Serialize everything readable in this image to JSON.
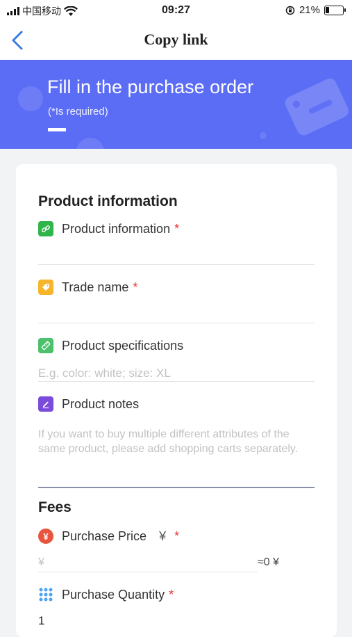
{
  "status_bar": {
    "carrier": "中国移动",
    "time": "09:27",
    "battery_percent": "21%",
    "battery_level": 0.21
  },
  "nav": {
    "title": "Copy link"
  },
  "banner": {
    "title": "Fill in the purchase order",
    "subtitle": "(*Is required)"
  },
  "product_section": {
    "title": "Product information",
    "fields": [
      {
        "label": "Product information",
        "required": "*",
        "value": "",
        "placeholder": ""
      },
      {
        "label": "Trade name",
        "required": "*",
        "value": "",
        "placeholder": ""
      },
      {
        "label": "Product specifications",
        "value": "",
        "placeholder": "E.g. color: white; size: XL"
      },
      {
        "label": "Product notes",
        "value": "",
        "placeholder": "If you want to buy multiple different attributes of the same product, please add shopping carts separately."
      }
    ]
  },
  "fees_section": {
    "title": "Fees",
    "price": {
      "label": "Purchase Price",
      "currency": "¥",
      "required": "*",
      "placeholder": "¥",
      "converted": "≈0 ¥"
    },
    "quantity": {
      "label": "Purchase Quantity",
      "required": "*",
      "value": "1"
    }
  },
  "colors": {
    "banner": "#5b6cf5",
    "required": "#e33333",
    "link_icon": "#2fb54a",
    "tag_icon": "#f6b52a",
    "spec_icon": "#4cc06a",
    "notes_icon": "#7b4bdc",
    "price_icon": "#e8553f",
    "qty_icon": "#4aa3f5"
  },
  "icons": {
    "back": "chevron-left-icon",
    "link": "link-icon",
    "tag": "tag-icon",
    "spec": "ruler-icon",
    "notes": "pen-icon",
    "price": "yen-icon",
    "quantity": "grid-dots-icon"
  }
}
